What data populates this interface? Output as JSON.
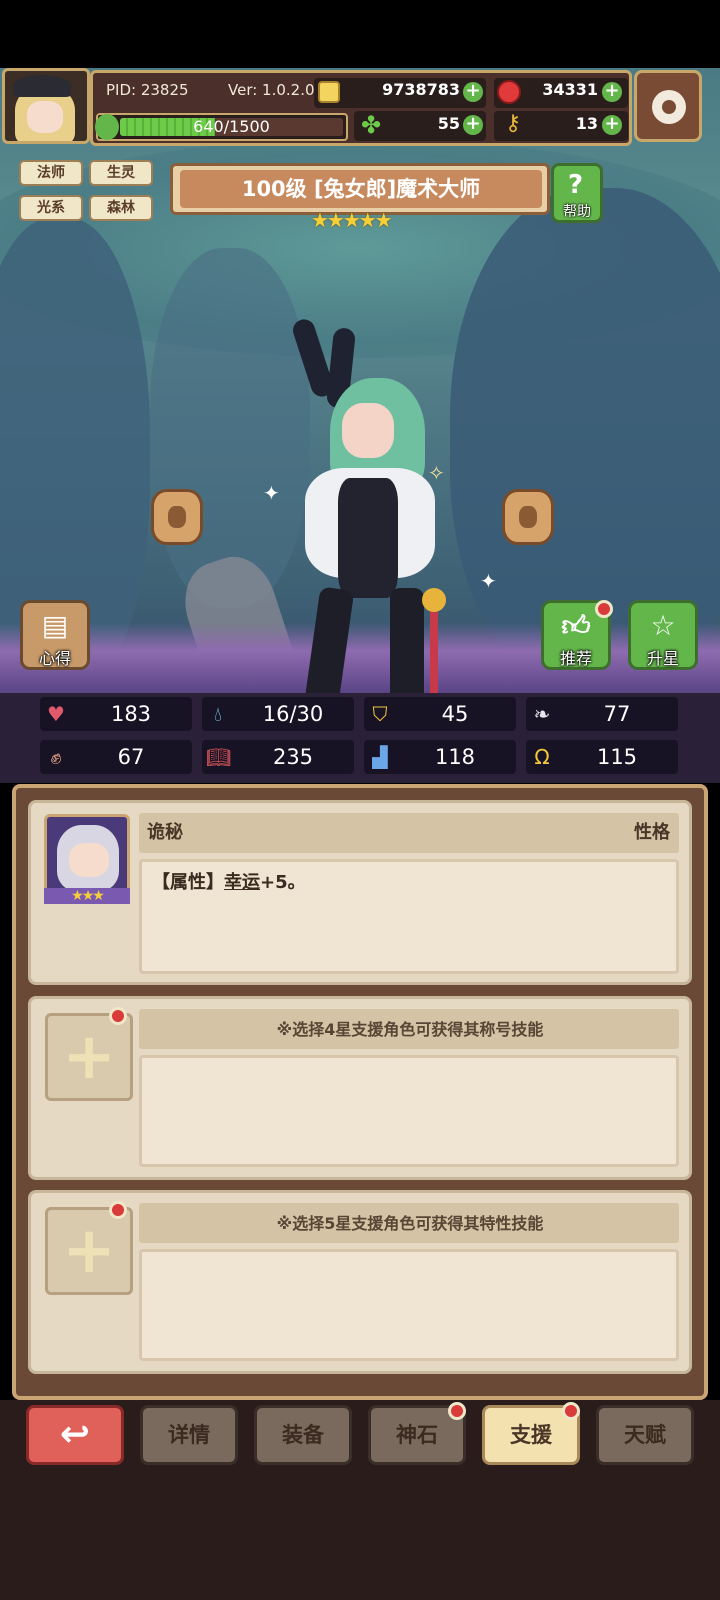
{
  "player": {
    "pid": "PID: 23825",
    "version": "Ver: 1.0.2.0",
    "exp": "640/1500",
    "exp_fraction": 0.4267
  },
  "resources": {
    "gold": "9738783",
    "ruby": "34331",
    "clover": "55",
    "key": "13"
  },
  "tags": [
    "法师",
    "生灵",
    "光系",
    "森林"
  ],
  "hero": {
    "title": "100级 [兔女郎]魔术大师",
    "stars": 5,
    "stars_text": "★★★★★"
  },
  "buttons": {
    "help": "帮助",
    "insight": "心得",
    "recommend": "推荐",
    "star_up": "升星"
  },
  "stats": [
    {
      "icon": "heart-icon",
      "value": "183"
    },
    {
      "icon": "drop-icon",
      "value": "16/30"
    },
    {
      "icon": "shield-icon",
      "value": "45"
    },
    {
      "icon": "wing-icon",
      "value": "77"
    },
    {
      "icon": "fist-icon",
      "value": "67"
    },
    {
      "icon": "book-icon",
      "value": "235"
    },
    {
      "icon": "boot-icon",
      "value": "118"
    },
    {
      "icon": "horseshoe-icon",
      "value": "115"
    }
  ],
  "support": {
    "trait_name": "诡秘",
    "trait_type": "性格",
    "trait_desc_prefix": "【属性】",
    "trait_desc_link": "幸运",
    "trait_desc_suffix": "+5。",
    "portrait_stars": "★★★",
    "slot4_hint": "※选择4星支援角色可获得其称号技能",
    "slot5_hint": "※选择5星支援角色可获得其特性技能"
  },
  "nav": {
    "back": "↩",
    "tabs": [
      "详情",
      "装备",
      "神石",
      "支援",
      "天赋"
    ],
    "active": "支援"
  },
  "colors": {
    "accent_green": "#63b64a",
    "alert_red": "#d93a3a",
    "panel_brown": "#6a4a37",
    "card_beige": "#e6d9c3"
  }
}
